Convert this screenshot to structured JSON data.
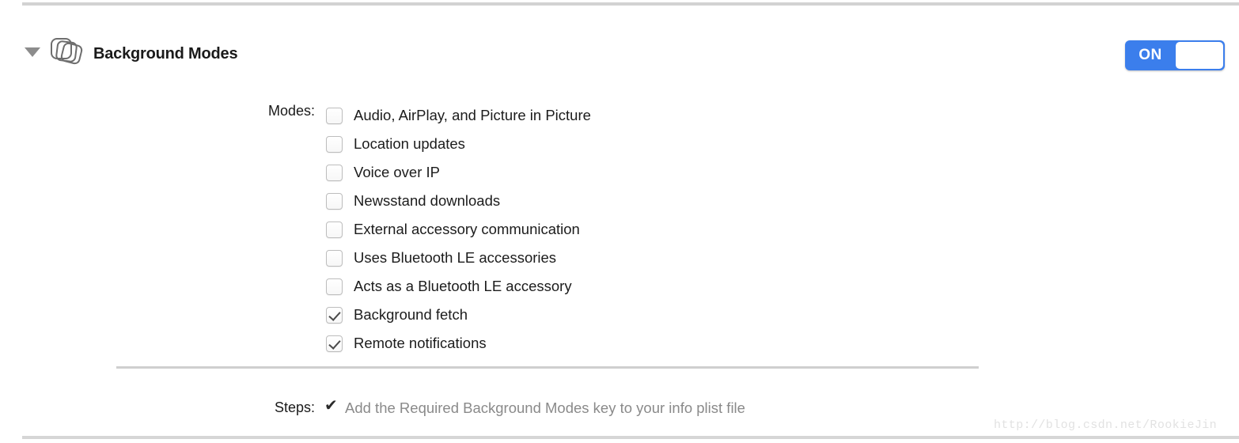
{
  "section": {
    "title": "Background Modes",
    "icon": "stacked-cards-icon",
    "disclosure": "triangle-down-icon",
    "expanded": true
  },
  "toggle": {
    "state_label": "ON",
    "on": true,
    "accent_color": "#3b7eec"
  },
  "modes": {
    "label": "Modes:",
    "items": [
      {
        "label": "Audio, AirPlay, and Picture in Picture",
        "checked": false
      },
      {
        "label": "Location updates",
        "checked": false
      },
      {
        "label": "Voice over IP",
        "checked": false
      },
      {
        "label": "Newsstand downloads",
        "checked": false
      },
      {
        "label": "External accessory communication",
        "checked": false
      },
      {
        "label": "Uses Bluetooth LE accessories",
        "checked": false
      },
      {
        "label": "Acts as a Bluetooth LE accessory",
        "checked": false
      },
      {
        "label": "Background fetch",
        "checked": true
      },
      {
        "label": "Remote notifications",
        "checked": true
      }
    ]
  },
  "steps": {
    "label": "Steps:",
    "check_glyph": "✔",
    "text": "Add the Required Background Modes key to your info plist file"
  },
  "watermark": {
    "text": "http://blog.csdn.net/RookieJin"
  }
}
